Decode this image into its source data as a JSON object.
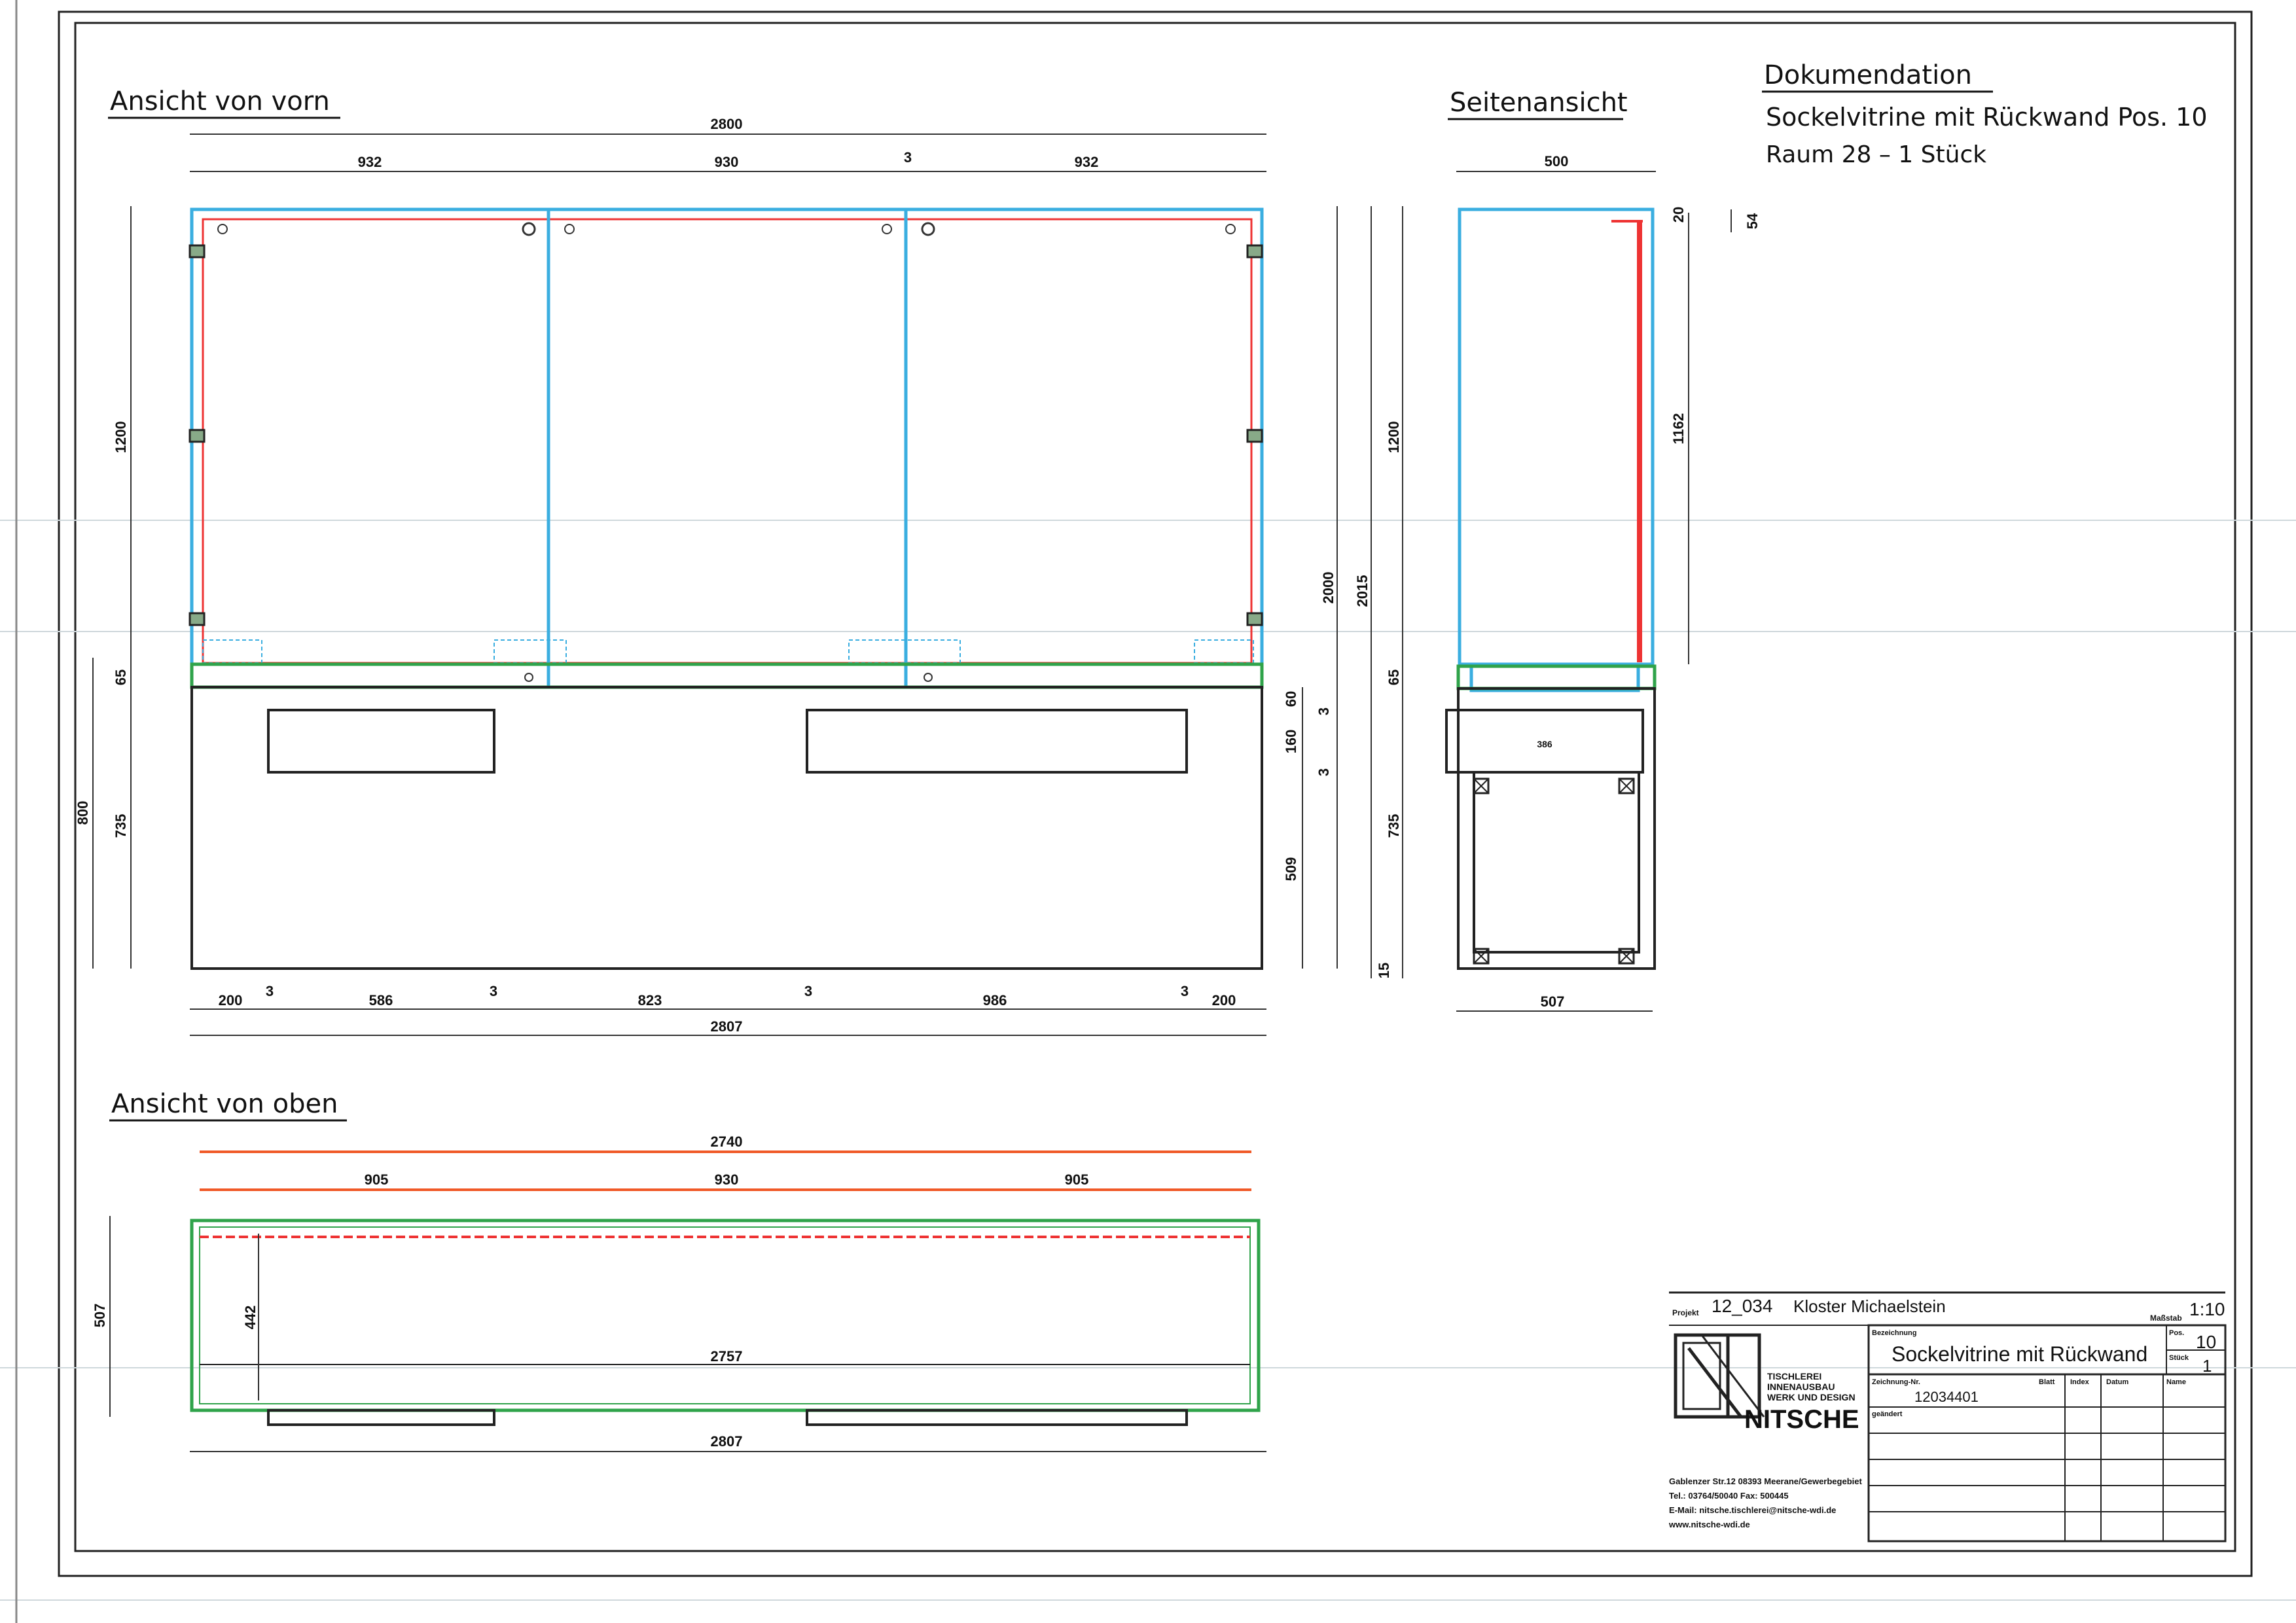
{
  "views": {
    "front": "Ansicht von vorn",
    "side": "Seitenansicht",
    "top": "Ansicht von oben"
  },
  "doc": {
    "heading": "Dokumendation",
    "line1": "Sockelvitrine mit Rückwand Pos. 10",
    "line2": "Raum 28  –  1 Stück"
  },
  "front_dims": {
    "overall_top": "2800",
    "seg1": "932",
    "seg2": "930",
    "gap": "3",
    "seg3": "932",
    "left_h1": "1200",
    "left_h2": "65",
    "left_h3": "735",
    "left_h4": "800",
    "right_a": "2000",
    "right_b": "2015",
    "right_c": "1200",
    "right_d": "65",
    "right_e": "735",
    "right_f": "15",
    "right_g": "60",
    "right_h": "3",
    "right_i": "160",
    "right_j": "3",
    "right_k": "509",
    "bottom": [
      "200",
      "3",
      "586",
      "3",
      "823",
      "3",
      "986",
      "3",
      "200"
    ],
    "bottom_total": "2807"
  },
  "side_dims": {
    "top": "500",
    "right1": "20",
    "right2": "54",
    "right3": "1162",
    "inner": "386",
    "bottom": "507"
  },
  "top_dims": {
    "overall": "2740",
    "seg1": "905",
    "seg2": "930",
    "seg3": "905",
    "inner_w": "2757",
    "depth": "507",
    "inner_d": "442",
    "bottom": "2807"
  },
  "titleblock": {
    "projekt_label": "Projekt",
    "projekt": "12_034",
    "projekt_name": "Kloster Michaelstein",
    "massstab_label": "Maßstab",
    "massstab": "1:10",
    "bezeichnung_label": "Bezeichnung",
    "bezeichnung": "Sockelvitrine mit Rückwand",
    "pos_label": "Pos.",
    "pos": "10",
    "stueck_label": "Stück",
    "stueck": "1",
    "zeichnung_label": "Zeichnung-Nr.",
    "zeichnung": "12034401",
    "blatt_label": "Blatt",
    "index_label": "Index",
    "datum_label": "Datum",
    "name_label": "Name",
    "geaendert_label": "geändert",
    "company_l1": "TISCHLEREI",
    "company_l2": "INNENAUSBAU",
    "company_l3": "WERK UND DESIGN",
    "company": "NITSCHE",
    "addr1": "Gablenzer Str.12  08393 Meerane/Gewerbegebiet",
    "addr2": "Tel.: 03764/50040       Fax: 500445",
    "addr3": "E-Mail: nitsche.tischlerei@nitsche-wdi.de",
    "addr4": "www.nitsche-wdi.de"
  }
}
